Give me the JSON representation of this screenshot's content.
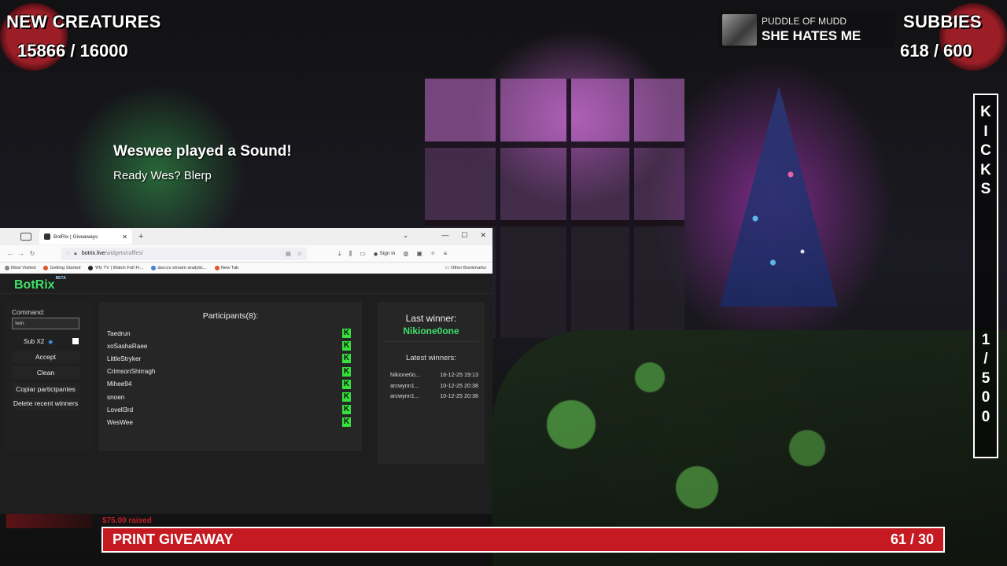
{
  "overlay": {
    "new_creatures": {
      "label": "NEW CREATURES",
      "count": "15866 / 16000"
    },
    "subbies": {
      "label": "SUBBIES",
      "count": "618 / 600"
    },
    "now_playing": {
      "artist": "PUDDLE OF MUDD",
      "song": "SHE HATES ME"
    },
    "alert": {
      "title": "Weswee played a Sound!",
      "message": "Ready Wes? Blerp"
    },
    "kicks": {
      "letters": [
        "K",
        "I",
        "C",
        "K",
        "S"
      ],
      "count_chars": [
        "1",
        "/",
        "5",
        "0",
        "0"
      ]
    },
    "raised": "$75.00 raised",
    "giveaway": {
      "title": "PRINT GIVEAWAY",
      "count": "61 / 30"
    },
    "colors": {
      "accent_red": "#c61a22",
      "botrix_green": "#3fe06b"
    }
  },
  "browser": {
    "tab_title": "BotRix | Giveaways",
    "url_host": "botrix.live",
    "url_path": "/widgets/raffles/",
    "sign_in": "Sign in",
    "bookmarks": [
      "Most Visited",
      "Getting Started",
      "Yify TV | Watch Full Fr...",
      "darccs stream analytic...",
      "New Tab"
    ],
    "other_bookmarks": "Other Bookmarks"
  },
  "botrix": {
    "brand": "BotRix",
    "beta": "BETA",
    "command_label": "Command:",
    "command_value": "!win",
    "sub_label": "Sub X2",
    "buttons": {
      "accept": "Accept",
      "clean": "Clean",
      "copy": "Copiar participantes",
      "delete": "Delete recent winners"
    },
    "participants_title": "Participants(8):",
    "participants": [
      "Taedrun",
      "xoSashaRaee",
      "LittleStryker",
      "CrimsonShirragh",
      "Mihee94",
      "snoen",
      "Lovell3rd",
      "WesWee"
    ],
    "last_winner_label": "Last winner:",
    "last_winner": "Nikione0one",
    "latest_label": "Latest winners:",
    "latest": [
      {
        "name": "Nikione0o...",
        "date": "16-12-25 19:13"
      },
      {
        "name": "arcwynn1...",
        "date": "10-12-25 20:38"
      },
      {
        "name": "arcwynn1...",
        "date": "10-12-25 20:38"
      }
    ]
  }
}
